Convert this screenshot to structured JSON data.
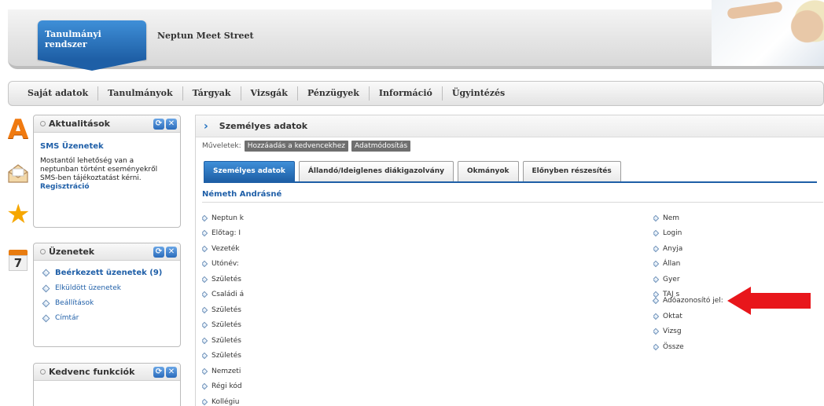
{
  "header": {
    "brand": "Tanulmányi rendszer",
    "site_name": "Neptun Meet Street"
  },
  "nav": {
    "items": [
      "Saját adatok",
      "Tanulmányok",
      "Tárgyak",
      "Vizsgák",
      "Pénzügyek",
      "Információ",
      "Ügyintézés"
    ]
  },
  "sidebar_icons": {
    "a_icon": "A",
    "calendar_day": "7"
  },
  "portlets": {
    "news": {
      "title": "Aktualitások",
      "item_title": "SMS Üzenetek",
      "item_text": "Mostantól lehetőség van a neptunban történt eseményekről SMS-ben tájékoztatást kérni.",
      "item_link": "Regisztráció"
    },
    "messages": {
      "title": "Üzenetek",
      "items": [
        "Beérkezett üzenetek (9)",
        "Elküldött üzenetek",
        "Beállítások",
        "Címtár"
      ]
    },
    "favorites": {
      "title": "Kedvenc funkciók"
    }
  },
  "main": {
    "title": "Személyes adatok",
    "ops_label": "Műveletek:",
    "ops_buttons": [
      "Hozzáadás a kedvencekhez",
      "Adatmódosítás"
    ],
    "tabs": [
      "Személyes adatok",
      "Állandó/Ideiglenes diákigazolvány",
      "Okmányok",
      "Előnyben részesítés"
    ],
    "person_name": "Németh Andrásné",
    "left_fields": [
      "Neptun k",
      "Előtag: I",
      "Vezeték",
      "Utónév:",
      "Születés",
      "Családi á",
      "Születés",
      "Születés",
      "Születés",
      "Születés",
      "Nemzeti",
      "Régi kód",
      "Kollégiu"
    ],
    "right_fields_top": [
      "Nem",
      "Login",
      "Anyja",
      "Állan",
      "Gyer",
      "TAJ s"
    ],
    "right_field_highlight": "Adóazonosító jel:",
    "right_fields_bottom": [
      "Oktat",
      "Vizsg",
      "Össze"
    ]
  },
  "colors": {
    "accent_blue": "#1e5fa6",
    "link_blue": "#1f5fa8",
    "arrow_red": "#e8161b",
    "icon_orange": "#f07a10"
  }
}
